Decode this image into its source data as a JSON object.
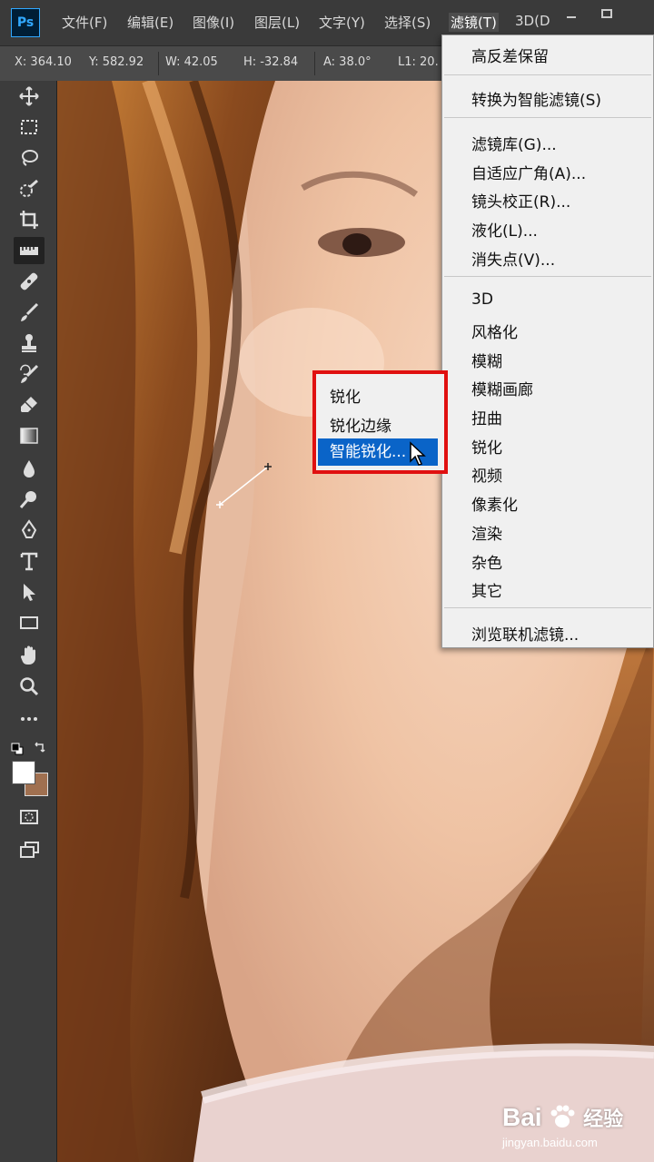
{
  "app": {
    "logo": "Ps"
  },
  "menubar": {
    "items": [
      "文件(F)",
      "编辑(E)",
      "图像(I)",
      "图层(L)",
      "文字(Y)",
      "选择(S)",
      "滤镜(T)",
      "3D(D"
    ],
    "active_index": 6,
    "window_controls": [
      "minimize",
      "maximize"
    ]
  },
  "options": {
    "x": "X: 364.10",
    "y": "Y: 582.92",
    "w": "W: 42.05",
    "h": "H: -32.84",
    "a": "A: 38.0°",
    "l1": "L1: 20."
  },
  "tools": [
    "move-icon",
    "marquee-icon",
    "lasso-icon",
    "quick-select-icon",
    "crop-icon",
    "ruler-icon",
    "healing-icon",
    "brush-icon",
    "stamp-icon",
    "history-brush-icon",
    "eraser-icon",
    "gradient-icon",
    "blur-icon",
    "dodge-icon",
    "pen-icon",
    "type-icon",
    "path-select-icon",
    "rectangle-icon",
    "hand-icon",
    "zoom-icon",
    "more-icon"
  ],
  "colors": {
    "foreground": "#ffffff",
    "background": "#a07050",
    "highlight": "#0a64c8",
    "callout": "#e01010"
  },
  "filter_menu": {
    "groups": [
      [
        "高反差保留"
      ],
      [
        "转换为智能滤镜(S)"
      ],
      [
        "滤镜库(G)...",
        "自适应广角(A)...",
        "镜头校正(R)...",
        "液化(L)...",
        "消失点(V)..."
      ],
      [
        "3D",
        "风格化",
        "模糊",
        "模糊画廊",
        "扭曲",
        "锐化",
        "视频",
        "像素化",
        "渲染",
        "杂色",
        "其它"
      ],
      [
        "浏览联机滤镜..."
      ]
    ]
  },
  "sharpen_submenu": {
    "items": [
      "锐化",
      "锐化边缘",
      "智能锐化..."
    ],
    "highlighted_index": 2
  },
  "watermark": {
    "brand": "Bai",
    "brand2": "经验",
    "url": "jingyan.baidu.com"
  }
}
